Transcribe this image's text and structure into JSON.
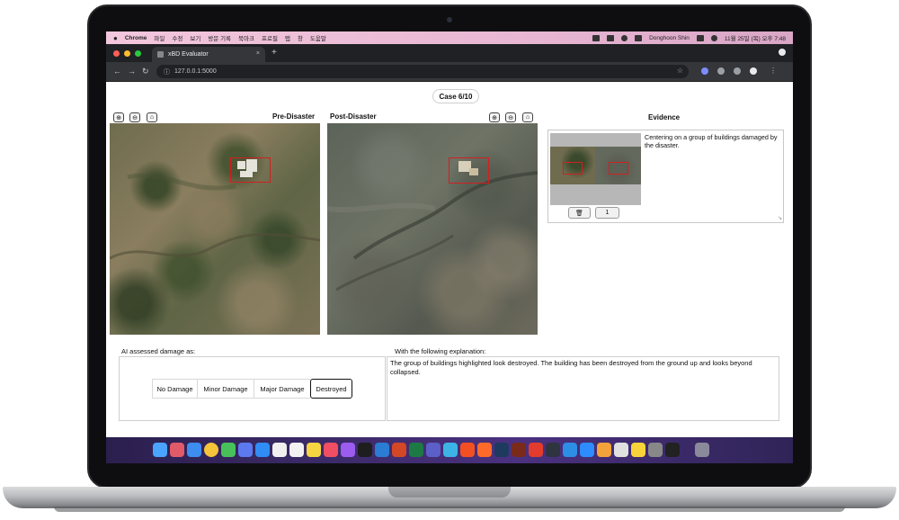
{
  "menubar": {
    "app": "Chrome",
    "menus": [
      "파일",
      "수정",
      "보기",
      "방문 기록",
      "북마크",
      "프로필",
      "탭",
      "창",
      "도움말"
    ],
    "user": "Donghoon Shin",
    "clock": "11월 25일 (목) 오후 7:48"
  },
  "browser": {
    "tab_title": "xBD Evaluator",
    "tab_close": "×",
    "new_tab": "+",
    "url": "127.0.0.1:5000"
  },
  "app": {
    "case": "Case 6/10",
    "pre_title": "Pre-Disaster",
    "post_title": "Post-Disaster",
    "evidence_title": "Evidence",
    "evidence_text": "Centering on a group of buildings damaged by the disaster.",
    "evidence_count": "1",
    "ai_label": "AI assessed damage as:",
    "options": [
      "No Damage",
      "Minor Damage",
      "Major Damage",
      "Destroyed"
    ],
    "selected_option": "Destroyed",
    "explanation_label": "With the following explanation:",
    "explanation_text": "The group of buildings highlighted look destroyed. The building has been destroyed from the ground up and looks beyond collapsed."
  },
  "icons": {
    "zoom_in": "zoom-in-icon",
    "zoom_out": "zoom-out-icon",
    "home": "home-icon",
    "trash": "trash-icon"
  },
  "colors": {
    "highlight": "#d21f1f",
    "dock": "#3a2a67",
    "menubar": "#e8b7d3"
  }
}
